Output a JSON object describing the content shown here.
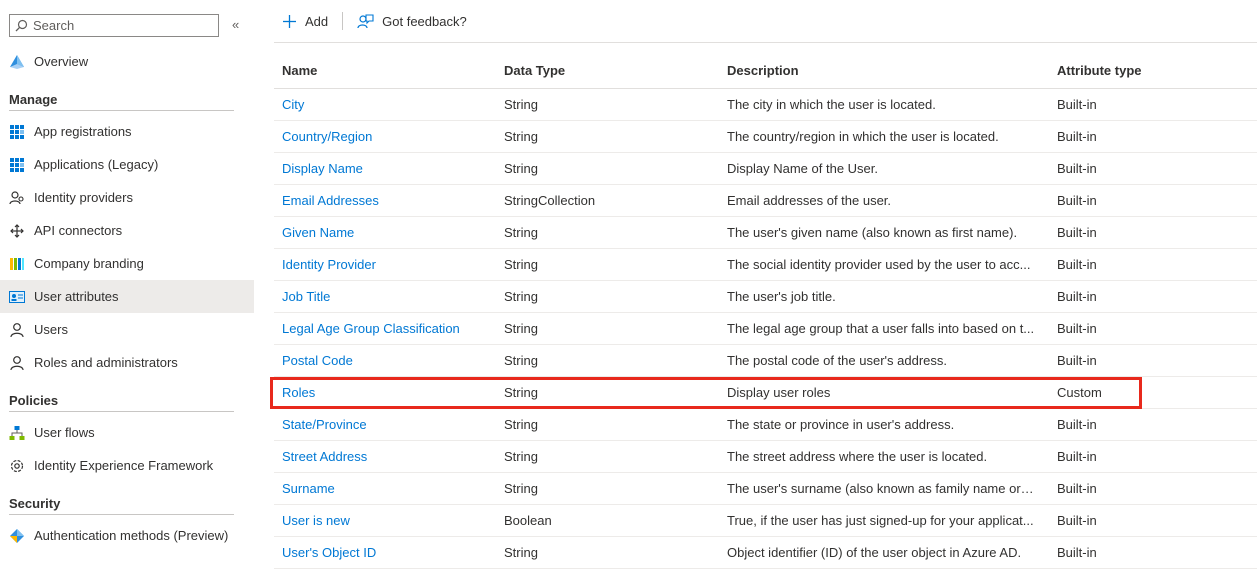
{
  "search": {
    "placeholder": "Search"
  },
  "sidebar": {
    "collapse_label": "«",
    "overview": {
      "label": "Overview",
      "icon": "overview-icon"
    },
    "sections": [
      {
        "title": "Manage",
        "items": [
          {
            "label": "App registrations",
            "icon": "app-registrations-icon"
          },
          {
            "label": "Applications (Legacy)",
            "icon": "applications-icon"
          },
          {
            "label": "Identity providers",
            "icon": "identity-providers-icon"
          },
          {
            "label": "API connectors",
            "icon": "api-connectors-icon"
          },
          {
            "label": "Company branding",
            "icon": "company-branding-icon"
          },
          {
            "label": "User attributes",
            "icon": "user-attributes-icon",
            "active": true
          },
          {
            "label": "Users",
            "icon": "user-icon"
          },
          {
            "label": "Roles and administrators",
            "icon": "roles-icon"
          }
        ]
      },
      {
        "title": "Policies",
        "items": [
          {
            "label": "User flows",
            "icon": "user-flows-icon"
          },
          {
            "label": "Identity Experience Framework",
            "icon": "gear-icon"
          }
        ]
      },
      {
        "title": "Security",
        "items": [
          {
            "label": "Authentication methods (Preview)",
            "icon": "authentication-methods-icon"
          }
        ]
      }
    ]
  },
  "toolbar": {
    "add_label": "Add",
    "feedback_label": "Got feedback?"
  },
  "table": {
    "headers": [
      "Name",
      "Data Type",
      "Description",
      "Attribute type"
    ],
    "rows": [
      [
        "City",
        "String",
        "The city in which the user is located.",
        "Built-in"
      ],
      [
        "Country/Region",
        "String",
        "The country/region in which the user is located.",
        "Built-in"
      ],
      [
        "Display Name",
        "String",
        "Display Name of the User.",
        "Built-in"
      ],
      [
        "Email Addresses",
        "StringCollection",
        "Email addresses of the user.",
        "Built-in"
      ],
      [
        "Given Name",
        "String",
        "The user's given name (also known as first name).",
        "Built-in"
      ],
      [
        "Identity Provider",
        "String",
        "The social identity provider used by the user to acc...",
        "Built-in"
      ],
      [
        "Job Title",
        "String",
        "The user's job title.",
        "Built-in"
      ],
      [
        "Legal Age Group Classification",
        "String",
        "The legal age group that a user falls into based on t...",
        "Built-in"
      ],
      [
        "Postal Code",
        "String",
        "The postal code of the user's address.",
        "Built-in"
      ],
      [
        "Roles",
        "String",
        "Display user roles",
        "Custom"
      ],
      [
        "State/Province",
        "String",
        "The state or province in user's address.",
        "Built-in"
      ],
      [
        "Street Address",
        "String",
        "The street address where the user is located.",
        "Built-in"
      ],
      [
        "Surname",
        "String",
        "The user's surname (also known as family name or l...",
        "Built-in"
      ],
      [
        "User is new",
        "Boolean",
        "True, if the user has just signed-up for your applicat...",
        "Built-in"
      ],
      [
        "User's Object ID",
        "String",
        "Object identifier (ID) of the user object in Azure AD.",
        "Built-in"
      ]
    ],
    "highlighted_row": "Roles"
  },
  "colors": {
    "link": "#0078d4",
    "highlight": "#e8291c",
    "active_bg": "#edebe9"
  }
}
